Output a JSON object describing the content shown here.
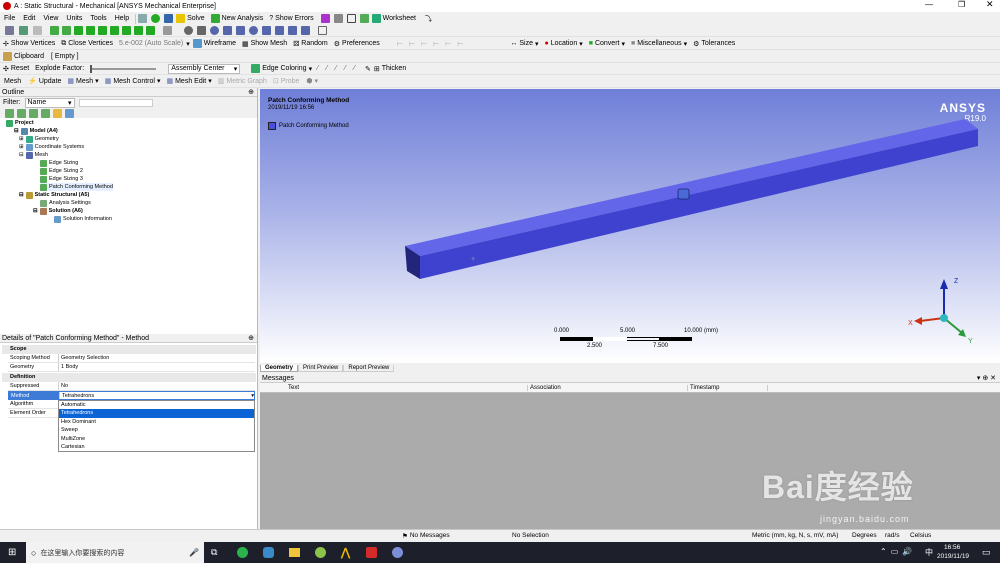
{
  "titlebar": {
    "title": "A : Static Structural - Mechanical [ANSYS Mechanical Enterprise]"
  },
  "menu": [
    "File",
    "Edit",
    "View",
    "Units",
    "Tools",
    "Help"
  ],
  "toolbar1": {
    "solve": "Solve",
    "new_analysis": "New Analysis",
    "show_errors": "Show Errors",
    "worksheet": "Worksheet"
  },
  "toolbar2": {
    "show_vertices": "Show Vertices",
    "close_vertices": "Close Vertices",
    "auto_scale": "5.e-002 (Auto Scale)",
    "wireframe": "Wireframe",
    "show_mesh": "Show Mesh",
    "random": "Random",
    "preferences": "Preferences",
    "size": "Size",
    "location": "Location",
    "convert": "Convert",
    "miscellaneous": "Miscellaneous",
    "tolerances": "Tolerances"
  },
  "toolbar3": {
    "clipboard": "Clipboard",
    "empty": "[ Empty ]"
  },
  "toolbar4": {
    "reset": "Reset",
    "explode_factor": "Explode Factor:",
    "assembly_center": "Assembly Center",
    "edge_coloring": "Edge Coloring",
    "thicken": "Thicken"
  },
  "toolbar5": {
    "mesh": "Mesh",
    "update": "Update",
    "mesh_btn": "Mesh",
    "mesh_control": "Mesh Control",
    "mesh_edit": "Mesh Edit",
    "metric_graph": "Metric Graph",
    "probe": "Probe"
  },
  "outline": {
    "title": "Outline",
    "filter_label": "Filter:",
    "filter_value": "Name",
    "tree": [
      {
        "label": "Project",
        "bold": true
      },
      {
        "label": "Model (A4)",
        "bold": true
      },
      {
        "label": "Geometry",
        "bold": false
      },
      {
        "label": "Coordinate Systems",
        "bold": false
      },
      {
        "label": "Mesh",
        "bold": false
      },
      {
        "label": "Edge Sizing",
        "bold": false
      },
      {
        "label": "Edge Sizing 2",
        "bold": false
      },
      {
        "label": "Edge Sizing 3",
        "bold": false
      },
      {
        "label": "Patch Conforming Method",
        "bold": false
      },
      {
        "label": "Static Structural (A5)",
        "bold": true
      },
      {
        "label": "Analysis Settings",
        "bold": false
      },
      {
        "label": "Solution (A6)",
        "bold": true
      },
      {
        "label": "Solution Information",
        "bold": false
      }
    ]
  },
  "details": {
    "title": "Details of \"Patch Conforming Method\" - Method",
    "scope": "Scope",
    "scoping_method_k": "Scoping Method",
    "scoping_method_v": "Geometry Selection",
    "geometry_k": "Geometry",
    "geometry_v": "1 Body",
    "definition": "Definition",
    "suppressed_k": "Suppressed",
    "suppressed_v": "No",
    "method_k": "Method",
    "method_v": "Tetrahedrons",
    "algorithm_k": "Algorithm",
    "element_order_k": "Element Order",
    "options": [
      "Automatic",
      "Tetrahedrons",
      "Hex Dominant",
      "Sweep",
      "MultiZone",
      "Cartesian"
    ]
  },
  "viewport": {
    "title": "Patch Conforming Method",
    "date": "2019/11/19 16:56",
    "legend": "Patch Conforming Method",
    "brand": "ANSYS",
    "version": "R19.0",
    "scale_0": "0.000",
    "scale_5000": "5.000",
    "scale_10000": "10.000 (mm)",
    "scale_2500": "2.500",
    "scale_7500": "7.500",
    "axis_x": "X",
    "axis_y": "Y",
    "axis_z": "Z",
    "body_color": "#4b4fd8"
  },
  "vtabs": [
    "Geometry",
    "Print Preview",
    "Report Preview"
  ],
  "messages": {
    "title": "Messages",
    "columns": [
      "Text",
      "Association",
      "Timestamp"
    ]
  },
  "status": {
    "no_messages": "No Messages",
    "no_selection": "No Selection",
    "units": "Metric (mm, kg, N, s, mV, mA)",
    "degrees": "Degrees",
    "rads": "rad/s",
    "celsius": "Celsius"
  },
  "taskbar": {
    "search": "在这里输入你要搜索的内容",
    "time": "16:56",
    "date": "2019/11/19"
  },
  "watermark": {
    "text": "Bai度经验",
    "url": "jingyan.baidu.com"
  }
}
